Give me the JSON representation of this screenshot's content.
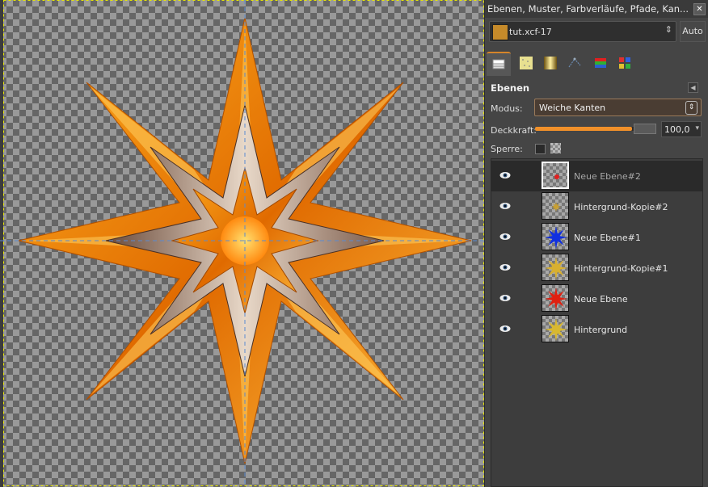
{
  "dock": {
    "title": "Ebenen, Muster, Farbverläufe, Pfade, Kan...",
    "close_icon": "close-icon",
    "image_selector": "tut.xcf-17",
    "auto_label": "Auto",
    "tabs": [
      "layers-tab-icon",
      "patterns-tab-icon",
      "gradients-tab-icon",
      "paths-tab-icon",
      "channels-tab-icon",
      "colors-tab-icon"
    ]
  },
  "layers_panel": {
    "title": "Ebenen",
    "mode_label": "Modus:",
    "mode_value": "Weiche Kanten",
    "opacity_label": "Deckkraft:",
    "opacity_value": "100,0",
    "opacity_fraction": 1.0,
    "lock_label": "Sperre:",
    "layers": [
      {
        "name": "Neue Ebene#2",
        "selected": true,
        "thumb": "red-dot",
        "color": "#e02020"
      },
      {
        "name": "Hintergrund-Kopie#2",
        "selected": false,
        "thumb": "small-star",
        "color": "#c9a030"
      },
      {
        "name": "Neue Ebene#1",
        "selected": false,
        "thumb": "blue-star",
        "color": "#1030e0"
      },
      {
        "name": "Hintergrund-Kopie#1",
        "selected": false,
        "thumb": "yellow-star",
        "color": "#d8b030"
      },
      {
        "name": "Neue Ebene",
        "selected": false,
        "thumb": "red-star",
        "color": "#e02010"
      },
      {
        "name": "Hintergrund",
        "selected": false,
        "thumb": "gold-star",
        "color": "#d8b830"
      }
    ]
  },
  "colors": {
    "accent": "#f0902a",
    "star_orange": "#f28a10",
    "star_gold": "#ffc830",
    "star_brown": "#9a7a6a"
  }
}
